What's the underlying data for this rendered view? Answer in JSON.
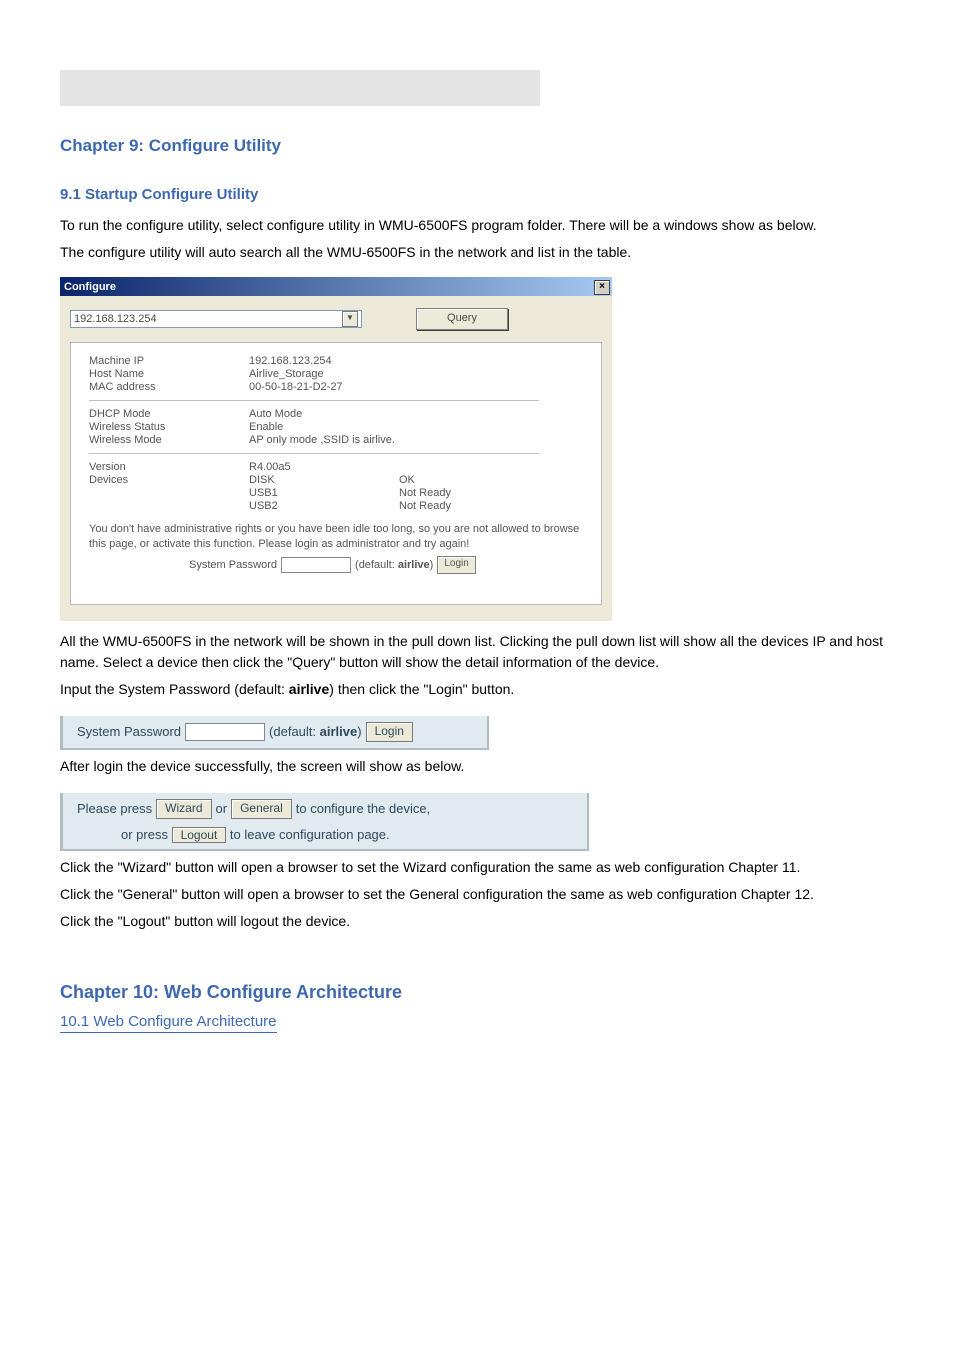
{
  "chapter": {
    "title": "Chapter 9: Configure Utility",
    "section": "9.1 Startup Configure Utility",
    "intro1": "To run the configure utility, select configure utility in WMU-6500FS program folder. There will be a windows show as below.",
    "intro2": "The configure utility will auto search all the WMU-6500FS in the network and list in the table."
  },
  "win": {
    "title": "Configure",
    "ip_field": "192.168.123.254",
    "query_btn": "Query",
    "rows": {
      "machine_ip_l": "Machine IP",
      "machine_ip_v": "192.168.123.254",
      "host_name_l": "Host Name",
      "host_name_v": "Airlive_Storage",
      "mac_l": "MAC address",
      "mac_v": "00-50-18-21-D2-27",
      "dhcp_l": "DHCP Mode",
      "dhcp_v": "Auto Mode",
      "wstat_l": "Wireless Status",
      "wstat_v": "Enable",
      "wmode_l": "Wireless Mode",
      "wmode_v": "AP only mode ,SSID is airlive.",
      "ver_l": "Version",
      "ver_v": "R4.00a5",
      "dev_l": "Devices",
      "disk_l": "DISK",
      "disk_v": "OK",
      "usb1_l": "USB1",
      "usb1_v": "Not Ready",
      "usb2_l": "USB2",
      "usb2_v": "Not Ready"
    },
    "auth_msg": "You don't have administrative rights or you have been idle too long, so you are not allowed to browse this page, or activate this function. Please login as administrator and try again!",
    "syspwd_label": "System Password",
    "default_hint_pre": "(default: ",
    "default_hint_bold": "airlive",
    "default_hint_post": ")",
    "login_btn": "Login"
  },
  "mid": {
    "para1": "All the WMU-6500FS in the network will be shown in the pull down list. Clicking the pull down list will show all the devices IP and host name. Select a device then click the \"Query\" button will show the detail information of the device.",
    "para2_a": "Input the System Password (default: ",
    "para2_b": "airlive",
    "para2_c": ") then click the \"Login\" button."
  },
  "crop1": {
    "syspwd": "System Password",
    "default_pre": "(default: ",
    "default_bold": "airlive",
    "default_post": ")",
    "login": "Login"
  },
  "after_login": "After login the device successfully, the screen will show as below.",
  "crop2": {
    "l1a": "Please press ",
    "wizard": "Wizard",
    "l1b": " or ",
    "general": "General",
    "l1c": " to configure the device,",
    "l2a": "or press ",
    "logout": "Logout",
    "l2b": " to leave configuration page."
  },
  "bottom": {
    "p1": "Click the \"Wizard\" button will open a browser to set the Wizard configuration the same as web configuration Chapter 11.",
    "p2": "Click the \"General\" button will open a browser to set the General configuration the same as web configuration Chapter 12.",
    "p3": "Click the \"Logout\" button will logout the device."
  },
  "toc_title": "Chapter 10: Web Configure Architecture",
  "toc_item": "10.1 Web Configure Architecture"
}
